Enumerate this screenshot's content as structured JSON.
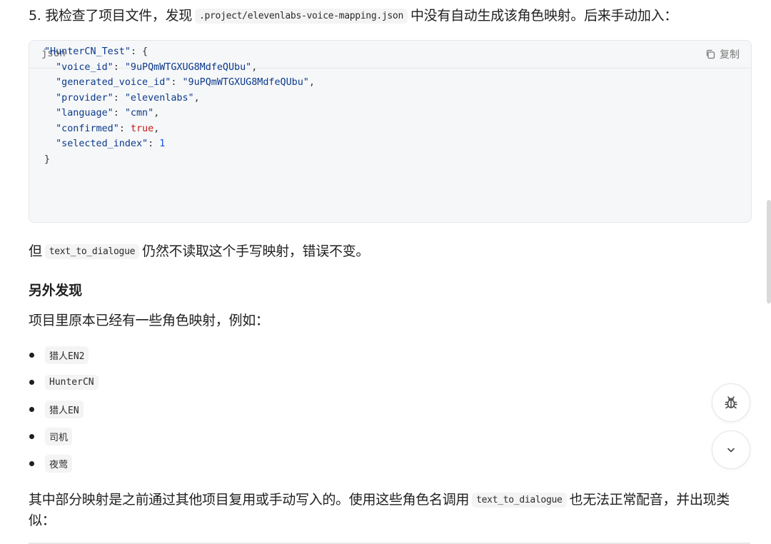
{
  "step5": {
    "prefix": "5. 我检查了项目文件，发现",
    "file_path": ".project/elevenlabs-voice-mapping.json",
    "suffix": "中没有自动生成该角色映射。后来手动加入："
  },
  "code_block": {
    "language": "json",
    "copy_label": "复制",
    "lines": {
      "l1_key": "\"HunterCN_Test\"",
      "l1_rest": ": {",
      "l2_key": "\"voice_id\"",
      "l2_val": "\"9uPQmWTGXUG8MdfeQUbu\"",
      "l3_key": "\"generated_voice_id\"",
      "l3_val": "\"9uPQmWTGXUG8MdfeQUbu\"",
      "l4_key": "\"provider\"",
      "l4_val": "\"elevenlabs\"",
      "l5_key": "\"language\"",
      "l5_val": "\"cmn\"",
      "l6_key": "\"confirmed\"",
      "l6_val": "true",
      "l7_key": "\"selected_index\"",
      "l7_val": "1",
      "l8": "}"
    }
  },
  "para2": {
    "prefix": "但",
    "code": "text_to_dialogue",
    "suffix": "仍然不读取这个手写映射，错误不变。"
  },
  "heading": "另外发现",
  "para3": "项目里原本已经有一些角色映射，例如：",
  "mappings": [
    "猎人EN2",
    "HunterCN",
    "猎人EN",
    "司机",
    "夜莺"
  ],
  "para4": {
    "prefix": "其中部分映射是之前通过其他项目复用或手动写入的。使用这些角色名调用",
    "code": "text_to_dialogue",
    "suffix": "也无法正常配音，并出现类似："
  },
  "icons": {
    "copy": "copy-icon",
    "bug": "bug-icon",
    "scroll_down": "chevron-down-icon"
  }
}
